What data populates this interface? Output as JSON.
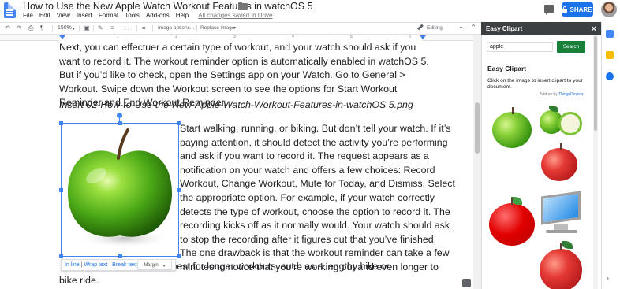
{
  "window": {
    "doc_title": "How to Use the New Apple Watch Workout Features in watchOS 5",
    "menu": [
      "File",
      "Edit",
      "View",
      "Insert",
      "Format",
      "Tools",
      "Add-ons",
      "Help"
    ],
    "saved_status": "All changes saved in Drive",
    "share_label": "SHARE"
  },
  "toolbar": {
    "zoom": "150%",
    "image_options": "Image options...",
    "replace_image": "Replace image",
    "mode": "Editing"
  },
  "ruler_numbers": [
    "1",
    "2",
    "3",
    "4",
    "5",
    "6"
  ],
  "document": {
    "para1": "Next, you can effectuer a certain type of workout, and your watch should ask if you want to record it. The workout reminder option is automatically enabled in watchOS 5. But if you’d like to check, open the Settings app on your Watch. Go to General > Workout. Swipe down the Workout screen to see the options for Start Workout Reminder and End Workout Reminder.",
    "caption": "Insert 02-How-to-Use-the-New-Apple-Watch-Workout-Features-in-watchOS 5.png",
    "wrap_lines": [
      "Start walking, running, or biking. But don’t tell your watch. If it’s",
      "paying attention, it should detect the activity you’re performing",
      "and ask if you want to record it. The request appears as a",
      "notification on your watch and offers a few choices: Record",
      "Workout, Change Workout, Mute for Today, and Dismiss. Select",
      "the appropriate option. For example, if your watch correctly",
      "detects the type of workout, choose the option to record it. The",
      "recording kicks off as it normally would. Your watch should ask",
      "to stop the recording after it figures out that you’ve finished.",
      "The one drawback is that the workout reminder can take a few",
      "minutes to notice that you’re working out and even longer to"
    ],
    "tail1": "o this feature is best for longer workouts, such as a lengthy hike or",
    "tail2": "bike ride."
  },
  "image_menu": {
    "inline": "In line",
    "wrap": "Wrap text",
    "break": "Break text",
    "margin": "Margin"
  },
  "panel": {
    "header": "Easy Clipart",
    "close": "×",
    "search_value": "apple",
    "search_button": "Search",
    "title": "Easy Clipart",
    "description": "Click on the image to insert clipart to your document.",
    "addon_by_prefix": "Add-on by",
    "addon_by_link": "ThingsReview"
  }
}
